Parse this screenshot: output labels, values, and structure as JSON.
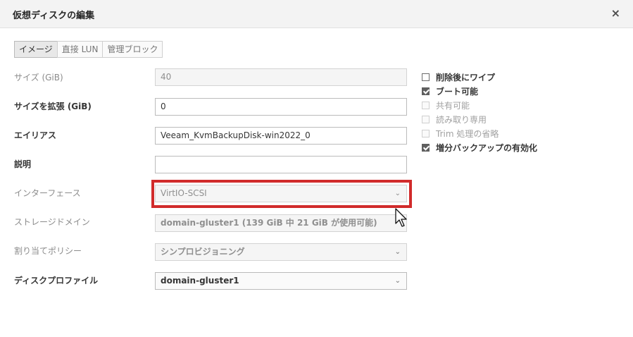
{
  "dialog": {
    "title": "仮想ディスクの編集",
    "close_label": "×"
  },
  "tabs": [
    {
      "label": "イメージ",
      "active": true
    },
    {
      "label": "直接 LUN",
      "active": false
    },
    {
      "label": "管理ブロック",
      "active": false
    }
  ],
  "form": {
    "size_label": "サイズ (GiB)",
    "size_value": "40",
    "extend_label": "サイズを拡張 (GiB)",
    "extend_value": "0",
    "alias_label": "エイリアス",
    "alias_value": "Veeam_KvmBackupDisk-win2022_0",
    "description_label": "説明",
    "description_value": "",
    "interface_label": "インターフェース",
    "interface_value": "VirtIO-SCSI",
    "storage_domain_label": "ストレージドメイン",
    "storage_domain_value": "domain-gluster1 (139 GiB 中 21 GiB が使用可能)",
    "allocation_label": "割り当てポリシー",
    "allocation_value": "シンプロビジョニング",
    "disk_profile_label": "ディスクプロファイル",
    "disk_profile_value": "domain-gluster1"
  },
  "options": [
    {
      "label": "削除後にワイプ",
      "checked": false,
      "enabled": true
    },
    {
      "label": "ブート可能",
      "checked": true,
      "enabled": true
    },
    {
      "label": "共有可能",
      "checked": false,
      "enabled": false
    },
    {
      "label": "読み取り専用",
      "checked": false,
      "enabled": false
    },
    {
      "label": "Trim 処理の省略",
      "checked": false,
      "enabled": false
    },
    {
      "label": "増分バックアップの有効化",
      "checked": true,
      "enabled": true
    }
  ],
  "icons": {
    "chevron": "chevron-down-icon",
    "close": "close-icon",
    "cursor": "mouse-pointer-icon"
  },
  "colors": {
    "highlight": "#d12b2b",
    "header_bg": "#f3f3f3"
  }
}
